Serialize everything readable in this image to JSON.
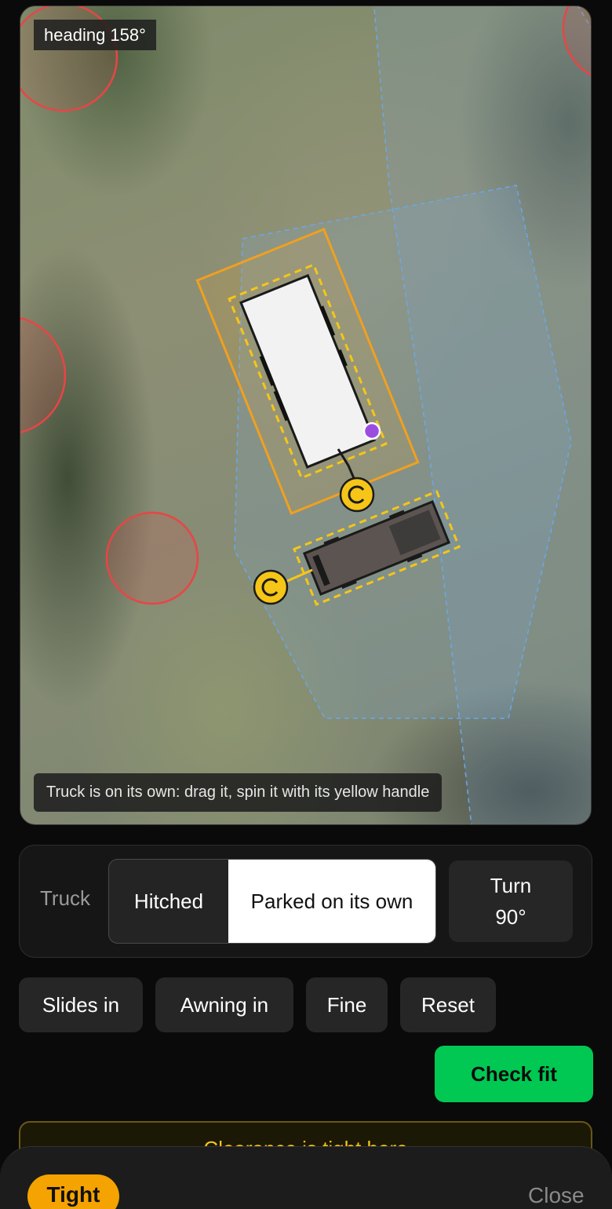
{
  "map": {
    "heading_label": "heading 158°",
    "hint": "Truck is on its own: drag it, spin it with its yellow handle",
    "icons": {
      "rotate_handle": "rotate-handle-icon",
      "hitch_marker": "hitch-point-icon"
    },
    "colors": {
      "envelope": "#f0a020",
      "handle": "#f5c518",
      "obstacle": "#e84545",
      "zone": "#6aa8e8",
      "hitch_point": "#9b4de0"
    }
  },
  "truck_panel": {
    "label": "Truck",
    "modes": [
      "Hitched",
      "Parked on its own"
    ],
    "selected_mode": "Parked on its own",
    "turn_button": "Turn 90°"
  },
  "actions": {
    "slides": "Slides in",
    "awning": "Awning in",
    "fine": "Fine",
    "reset": "Reset",
    "check_fit": "Check fit"
  },
  "warning": {
    "text": "Clearance is tight here"
  },
  "sheet": {
    "badge": "Tight",
    "close": "Close",
    "colors": {
      "badge": "#f5a300",
      "check_fit": "#00c853"
    }
  }
}
